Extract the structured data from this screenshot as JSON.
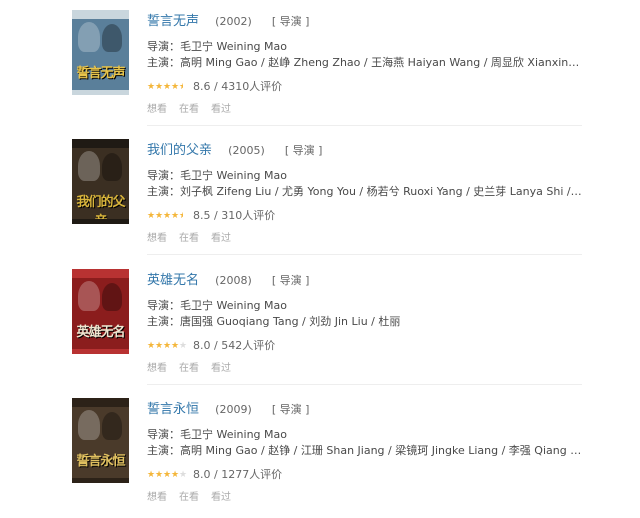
{
  "labels": {
    "director": "导演：",
    "cast": "主演：",
    "sep": " / "
  },
  "items": [
    {
      "title": "誓言无声",
      "year": "(2002)",
      "role": "[ 导演 ]",
      "director": "毛卫宁 Weining Mao",
      "cast": "高明 Ming Gao / 赵峥 Zheng Zhao / 王海燕 Haiyan Wang / 周显欣 Xianxin Zhou / 寇振海 Z...",
      "rating_value": 8.6,
      "stars": 4.5,
      "rating_text": "8.6 / 4310人评价",
      "actions": [
        "想看",
        "在看",
        "看过"
      ],
      "poster_text": "誓言无声",
      "poster_colors": {
        "bg": "#5a7f9a",
        "top": "#c9d6dd",
        "accent": "#e8c44a"
      }
    },
    {
      "title": "我们的父亲",
      "year": "(2005)",
      "role": "[ 导演 ]",
      "director": "毛卫宁 Weining Mao",
      "cast": "刘子枫 Zifeng Liu / 尤勇 Yong You / 杨若兮 Ruoxi Yang / 史兰芽 Lanya Shi / 刘禹 Yu Liu / ...",
      "rating_value": 8.5,
      "stars": 4.5,
      "rating_text": "8.5 / 310人评价",
      "actions": [
        "想看",
        "在看",
        "看过"
      ],
      "poster_text": "我们的父亲",
      "poster_colors": {
        "bg": "#3b2f22",
        "top": "#1f1a14",
        "accent": "#d9b53c"
      }
    },
    {
      "title": "英雄无名",
      "year": "(2008)",
      "role": "[ 导演 ]",
      "director": "毛卫宁 Weining Mao",
      "cast": "唐国强 Guoqiang Tang / 刘劲 Jin Liu / 杜丽",
      "rating_value": 8.0,
      "stars": 4,
      "rating_text": "8.0 / 542人评价",
      "actions": [
        "想看",
        "在看",
        "看过"
      ],
      "poster_text": "英雄无名",
      "poster_colors": {
        "bg": "#8b1d1d",
        "top": "#b83232",
        "accent": "#f0e6d0"
      }
    },
    {
      "title": "誓言永恒",
      "year": "(2009)",
      "role": "[ 导演 ]",
      "director": "毛卫宁 Weining Mao",
      "cast": "高明 Ming Gao / 赵铮 / 江珊 Shan Jiang / 梁镜珂 Jingke Liang / 李强 Qiang Li / 陶飞霏 Feif...",
      "rating_value": 8.0,
      "stars": 4,
      "rating_text": "8.0 / 1277人评价",
      "actions": [
        "想看",
        "在看",
        "看过"
      ],
      "poster_text": "誓言永恒",
      "poster_colors": {
        "bg": "#4a3a2a",
        "top": "#2c2218",
        "accent": "#e0c060"
      }
    }
  ]
}
